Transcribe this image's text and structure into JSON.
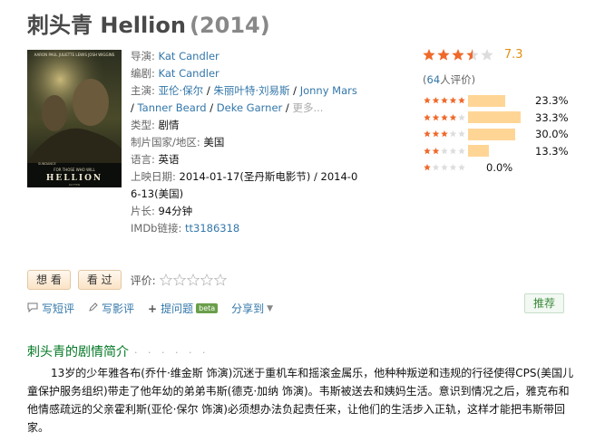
{
  "header": {
    "title": "刺头青 Hellion",
    "year": "(2014)"
  },
  "poster": {
    "top_credits": "AARON PAUL   JULIETTE LEWIS   JOSH WIGGINS",
    "title_text": "HELLION",
    "tagline": "FOR THOSE WHO WILL",
    "sundance": "SUNDANCE",
    "bottom_credit": "ROTTEN"
  },
  "info": {
    "director_label": "导演",
    "director": "Kat Candler",
    "writer_label": "编剧",
    "writer": "Kat Candler",
    "cast_label": "主演",
    "cast": [
      "亚伦·保尔",
      "朱丽叶特·刘易斯",
      "Jonny Mars",
      "Tanner Beard",
      "Deke Garner"
    ],
    "cast_more": "更多...",
    "genre_label": "类型:",
    "genre": "剧情",
    "country_label": "制片国家/地区:",
    "country": "美国",
    "language_label": "语言:",
    "language": "英语",
    "release_label": "上映日期:",
    "release_line1": "2014-01-17(圣丹斯电影节) / 2014-0",
    "release_line2": "6-13(美国)",
    "runtime_label": "片长:",
    "runtime": "94分钟",
    "imdb_label": "IMDb链接:",
    "imdb": "tt3186318"
  },
  "rating": {
    "score": "7.3",
    "stars_out_of_5": 3.5,
    "votes": "(64人评价)",
    "distribution": [
      {
        "stars": 5,
        "percent": "23.3%",
        "value": 23.3
      },
      {
        "stars": 4,
        "percent": "33.3%",
        "value": 33.3
      },
      {
        "stars": 3,
        "percent": "30.0%",
        "value": 30.0
      },
      {
        "stars": 2,
        "percent": "13.3%",
        "value": 13.3
      },
      {
        "stars": 1,
        "percent": "0.0%",
        "value": 0.0
      }
    ],
    "star_color": "#f0692a",
    "empty_star_color": "#dddddd",
    "bar_color": "#ffd596"
  },
  "actions": {
    "want": "想 看",
    "seen": "看 过",
    "rate_label": "评价:"
  },
  "toolbar": {
    "short_review": "写短评",
    "review": "写影评",
    "question": "提问题",
    "beta": "beta",
    "share": "分享到",
    "recommend": "推荐"
  },
  "summary": {
    "heading": "刺头青的剧情简介",
    "dots": "· · · · · ·",
    "text": "13岁的少年雅各布(乔什·维金斯 饰演)沉迷于重机车和摇滚金属乐，他种种叛逆和违规的行径使得CPS(美国儿童保护服务组织)带走了他年幼的弟弟韦斯(德克·加纳 饰演)。韦斯被送去和姨妈生活。意识到情况之后，雅克布和他情感疏远的父亲霍利斯(亚伦·保尔 饰演)必须想办法负起责任来，让他们的生活步入正轨，这样才能把韦斯带回家。"
  }
}
